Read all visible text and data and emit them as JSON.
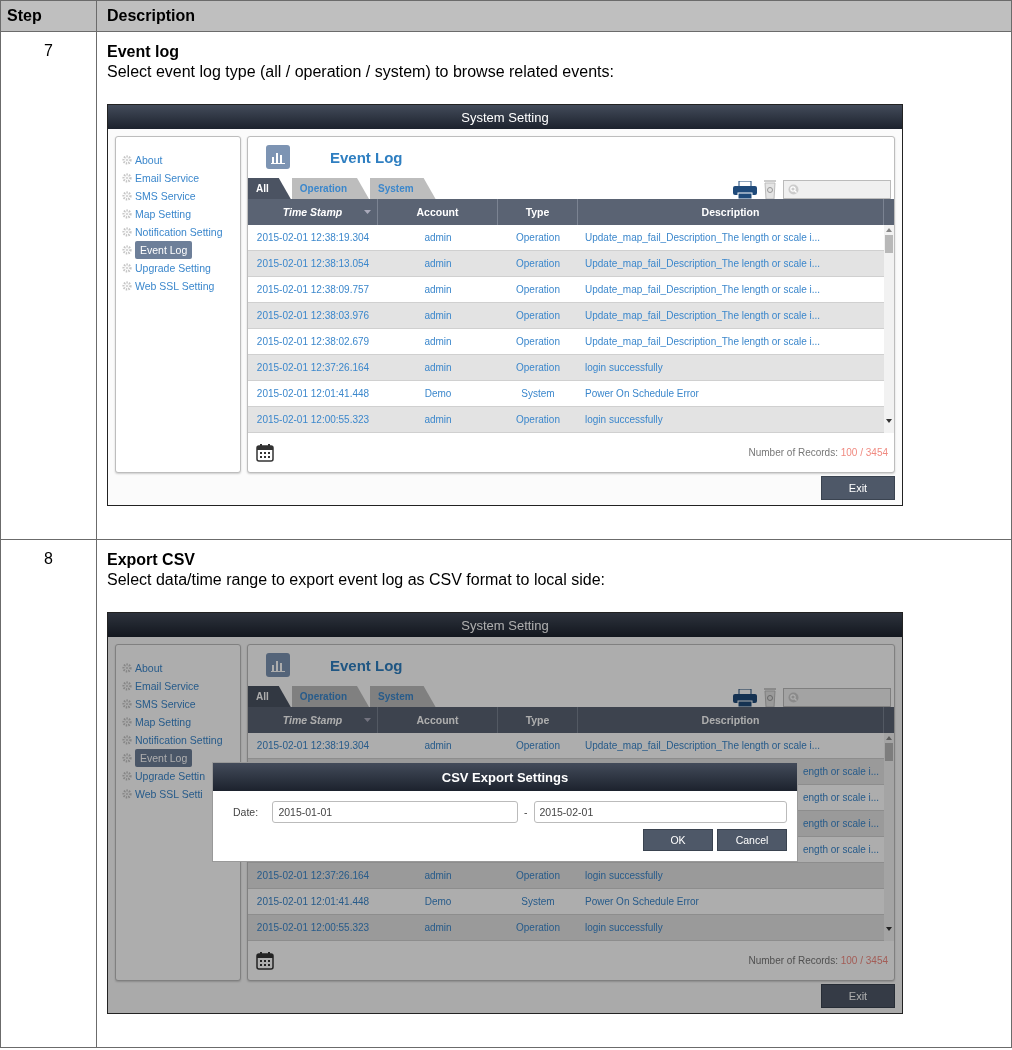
{
  "table": {
    "columns": [
      "Step",
      "Description"
    ],
    "rows": [
      {
        "step": "7",
        "title": "Event log",
        "text": "Select event log type (all / operation / system) to browse related events:",
        "screenshot": {
          "window_title": "System Setting",
          "sidebar": [
            {
              "label": "About",
              "selected": false
            },
            {
              "label": "Email Service",
              "selected": false
            },
            {
              "label": "SMS Service",
              "selected": false
            },
            {
              "label": "Map Setting",
              "selected": false
            },
            {
              "label": "Notification Setting",
              "selected": false
            },
            {
              "label": "Event Log",
              "selected": true
            },
            {
              "label": "Upgrade Setting",
              "selected": false
            },
            {
              "label": "Web SSL Setting",
              "selected": false
            }
          ],
          "panel_title": "Event Log",
          "tabs": [
            {
              "label": "All",
              "selected": true
            },
            {
              "label": "Operation",
              "selected": false
            },
            {
              "label": "System",
              "selected": false
            }
          ],
          "columns": [
            {
              "label": "Time Stamp",
              "sorted": true
            },
            {
              "label": "Account",
              "sorted": false
            },
            {
              "label": "Type",
              "sorted": false
            },
            {
              "label": "Description",
              "sorted": false
            }
          ],
          "rows": [
            {
              "kind": "entry",
              "time_stamp": "2015-02-01 12:38:19.304",
              "account": "admin",
              "type": "Operation",
              "description": "Update_map_fail_Description_The length or scale i..."
            },
            {
              "kind": "entry",
              "time_stamp": "2015-02-01 12:38:13.054",
              "account": "admin",
              "type": "Operation",
              "description": "Update_map_fail_Description_The length or scale i..."
            },
            {
              "kind": "entry",
              "time_stamp": "2015-02-01 12:38:09.757",
              "account": "admin",
              "type": "Operation",
              "description": "Update_map_fail_Description_The length or scale i..."
            },
            {
              "kind": "entry",
              "time_stamp": "2015-02-01 12:38:03.976",
              "account": "admin",
              "type": "Operation",
              "description": "Update_map_fail_Description_The length or scale i..."
            },
            {
              "kind": "entry",
              "time_stamp": "2015-02-01 12:38:02.679",
              "account": "admin",
              "type": "Operation",
              "description": "Update_map_fail_Description_The length or scale i..."
            },
            {
              "kind": "entry",
              "time_stamp": "2015-02-01 12:37:26.164",
              "account": "admin",
              "type": "Operation",
              "description": "login successfully"
            },
            {
              "kind": "entry",
              "time_stamp": "2015-02-01 12:01:41.448",
              "account": "Demo",
              "type": "System",
              "description": "Power On Schedule Error"
            },
            {
              "kind": "entry",
              "time_stamp": "2015-02-01 12:00:55.323",
              "account": "admin",
              "type": "Operation",
              "description": "login successfully"
            }
          ],
          "records_label": "Number of Records:",
          "records_count": "100 / 3454",
          "exit_button": "Exit"
        }
      },
      {
        "step": "8",
        "title": "Export CSV",
        "text": "Select data/time range to export event log as CSV format to local side:",
        "screenshot": {
          "window_title": "System Setting",
          "sidebar": [
            {
              "label": "About",
              "selected": false
            },
            {
              "label": "Email Service",
              "selected": false
            },
            {
              "label": "SMS Service",
              "selected": false
            },
            {
              "label": "Map Setting",
              "selected": false
            },
            {
              "label": "Notification Setting",
              "selected": false
            },
            {
              "label": "Event Log",
              "selected": true
            },
            {
              "label": "Upgrade Settin",
              "selected": false
            },
            {
              "label": "Web SSL Setti",
              "selected": false
            }
          ],
          "panel_title": "Event Log",
          "tabs": [
            {
              "label": "All",
              "selected": true
            },
            {
              "label": "Operation",
              "selected": false
            },
            {
              "label": "System",
              "selected": false
            }
          ],
          "columns": [
            {
              "label": "Time Stamp",
              "sorted": true
            },
            {
              "label": "Account",
              "sorted": false
            },
            {
              "label": "Type",
              "sorted": false
            },
            {
              "label": "Description",
              "sorted": false
            }
          ],
          "rows": [
            {
              "kind": "entry",
              "time_stamp": "2015-02-01 12:38:19.304",
              "account": "admin",
              "type": "Operation",
              "description": "Update_map_fail_Description_The length or scale i..."
            },
            {
              "kind": "covered",
              "description": "ength or scale i..."
            },
            {
              "kind": "covered",
              "description": "ength or scale i..."
            },
            {
              "kind": "covered",
              "description": "ength or scale i..."
            },
            {
              "kind": "covered",
              "description": "ength or scale i..."
            },
            {
              "kind": "entry",
              "time_stamp": "2015-02-01 12:37:26.164",
              "account": "admin",
              "type": "Operation",
              "description": "login successfully"
            },
            {
              "kind": "entry",
              "time_stamp": "2015-02-01 12:01:41.448",
              "account": "Demo",
              "type": "System",
              "description": "Power On Schedule Error"
            },
            {
              "kind": "entry",
              "time_stamp": "2015-02-01 12:00:55.323",
              "account": "admin",
              "type": "Operation",
              "description": "login successfully"
            }
          ],
          "records_label": "Number of Records:",
          "records_count": "100 / 3454",
          "exit_button": "Exit",
          "dialog": {
            "title": "CSV Export Settings",
            "date_label": "Date:",
            "from": "2015-01-01",
            "separator": "-",
            "to": "2015-02-01",
            "buttons": [
              "OK",
              "Cancel"
            ]
          }
        }
      }
    ]
  }
}
